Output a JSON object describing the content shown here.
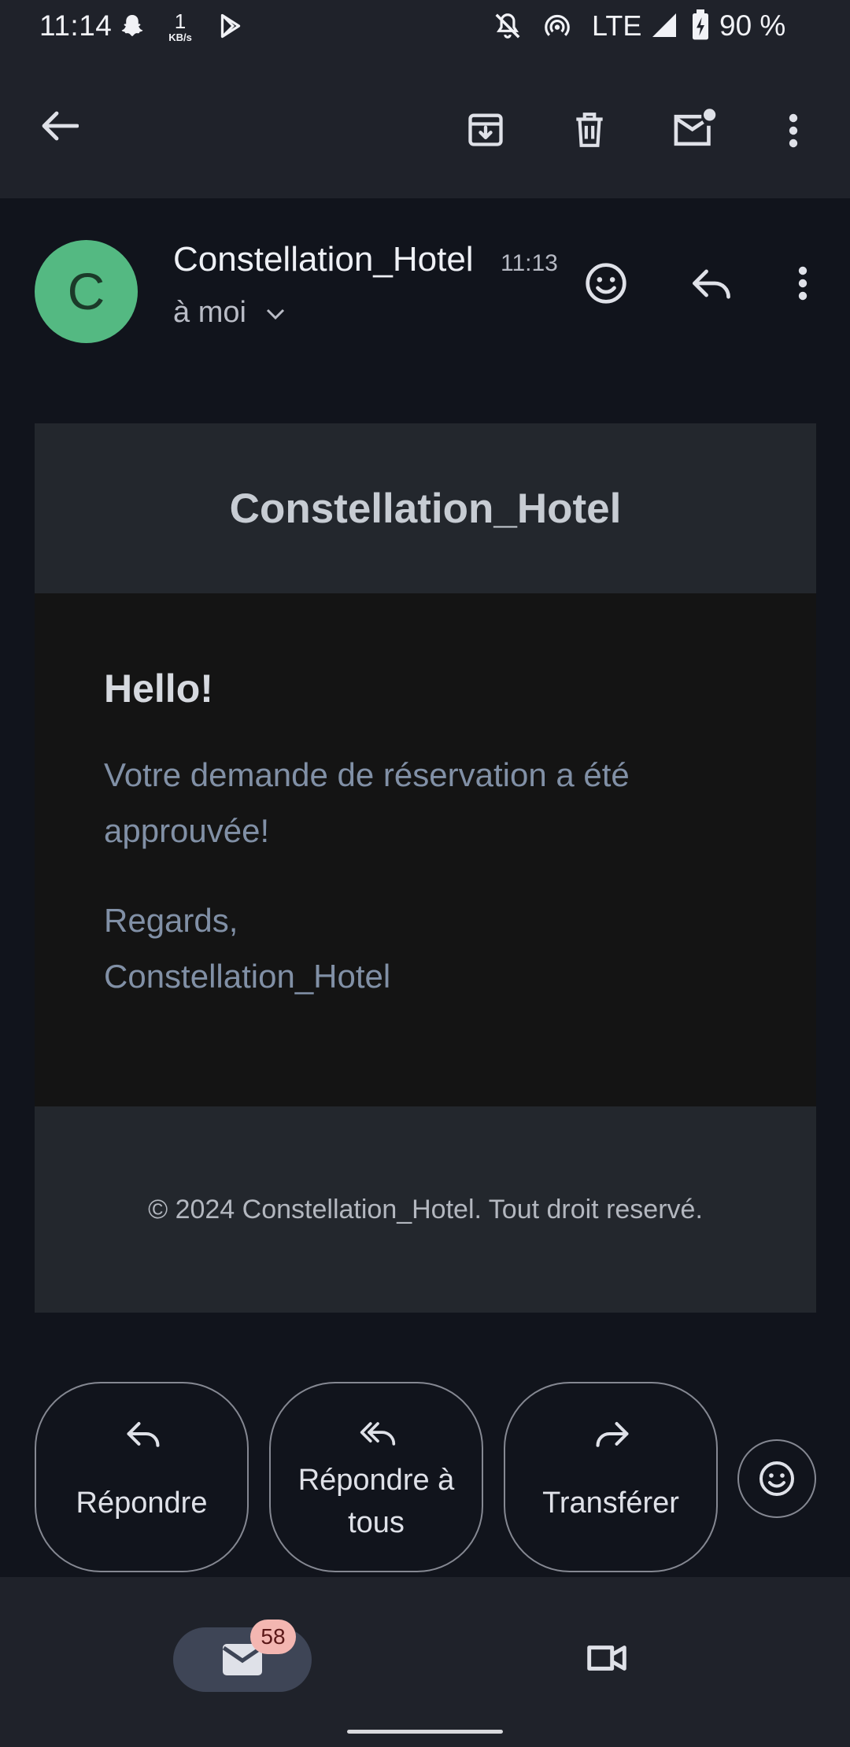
{
  "status_bar": {
    "time": "11:14",
    "net_speed_value": "1",
    "net_speed_unit": "KB/s",
    "network": "LTE",
    "battery": "90 %",
    "icons": [
      "snapchat-icon",
      "play-store-icon",
      "notifications-off-icon",
      "hotspot-icon",
      "signal-icon",
      "battery-icon"
    ]
  },
  "toolbar": {
    "icons": [
      "back-arrow-icon",
      "archive-icon",
      "delete-icon",
      "mark-unread-icon",
      "more-vert-icon"
    ]
  },
  "sender": {
    "initial": "C",
    "name": "Constellation_Hotel",
    "time": "11:13",
    "recipient": "à moi",
    "avatar_color": "#54b982"
  },
  "email": {
    "header_title": "Constellation_Hotel",
    "greeting": "Hello!",
    "message": "Votre demande de réservation a été approuvée!",
    "closing": "Regards,",
    "signature": "Constellation_Hotel",
    "footer": "© 2024 Constellation_Hotel. Tout droit reservé."
  },
  "actions": {
    "reply": "Répondre",
    "reply_all": "Répondre à tous",
    "forward": "Transférer"
  },
  "bottom_nav": {
    "mail_badge": "58",
    "items": [
      "mail-icon",
      "meet-video-icon"
    ]
  },
  "colors": {
    "background": "#11141c",
    "bar": "#1f222a",
    "badge": "#f3b6b1",
    "pill": "#3e4556"
  }
}
